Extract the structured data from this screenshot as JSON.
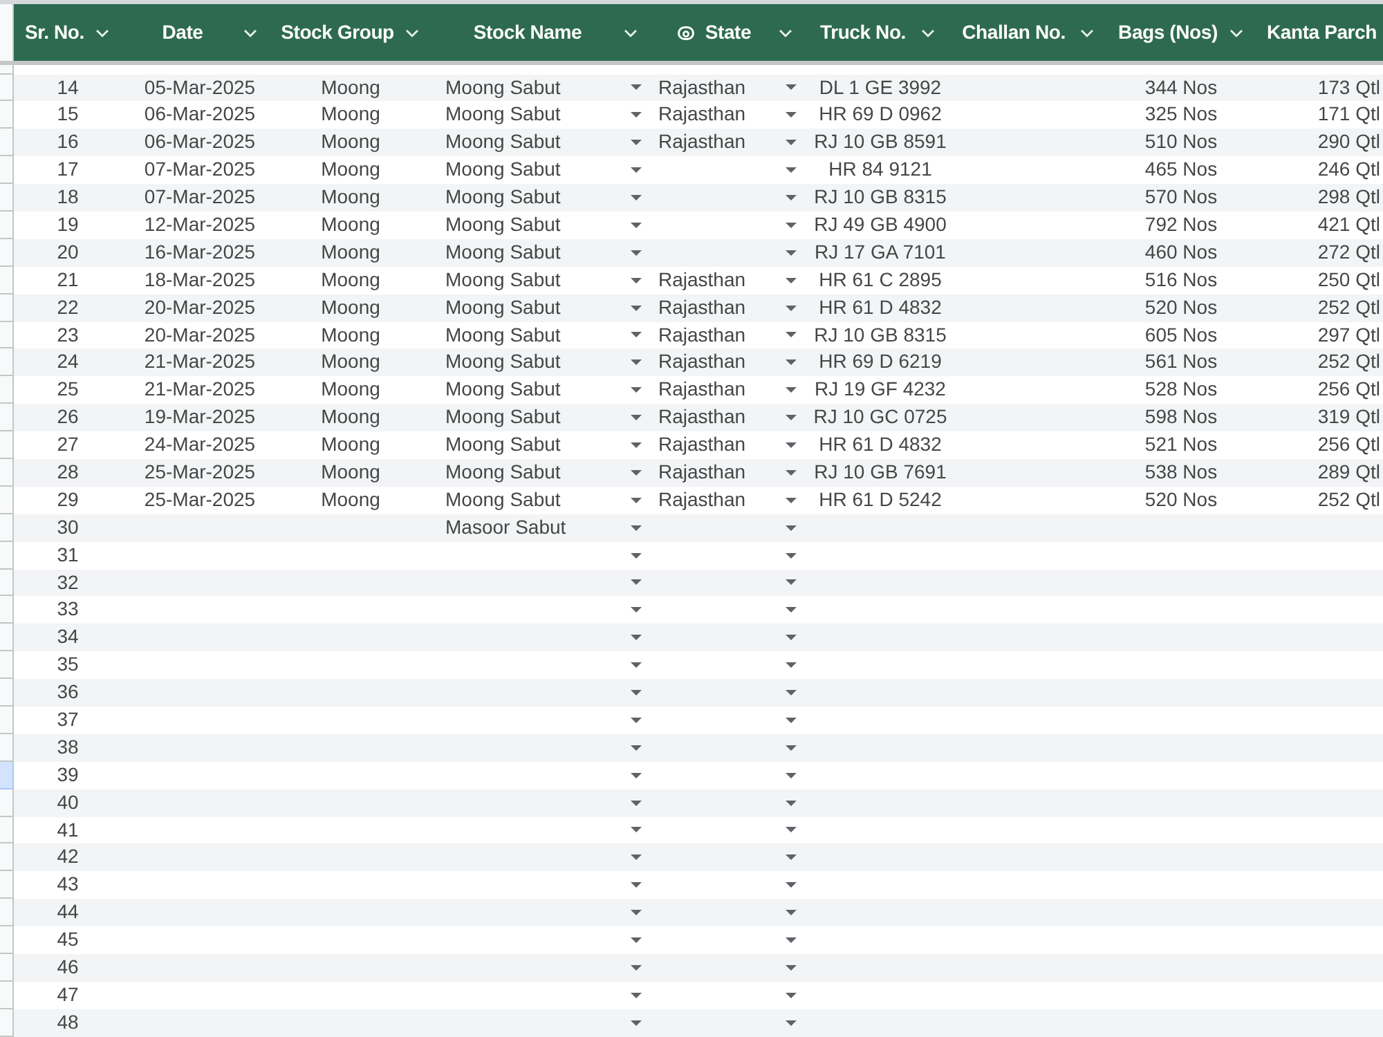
{
  "sheet": {
    "columns": [
      {
        "label": "Sr. No.",
        "kind": "text",
        "filter": true
      },
      {
        "label": "Date",
        "kind": "text",
        "filter": true
      },
      {
        "label": "Stock Group",
        "kind": "text",
        "filter": true
      },
      {
        "label": "Stock Name",
        "kind": "dropdown",
        "filter": true
      },
      {
        "label": "State",
        "kind": "chip",
        "filter": true
      },
      {
        "label": "Truck No.",
        "kind": "text",
        "filter": true
      },
      {
        "label": "Challan No.",
        "kind": "text",
        "filter": true
      },
      {
        "label": "Bags (Nos)",
        "kind": "text",
        "filter": true
      },
      {
        "label": "Kanta Parch",
        "kind": "text",
        "filter": false
      }
    ],
    "rows": [
      {
        "sr_no": "14",
        "date": "05-Mar-2025",
        "stock_group": "Moong",
        "stock_name": "Moong Sabut",
        "state": "Rajasthan",
        "truck_no": "DL 1 GE 3992",
        "bags_nos": "344 Nos",
        "column_9": "173 Qtl",
        "selected": false
      },
      {
        "sr_no": "15",
        "date": "06-Mar-2025",
        "stock_group": "Moong",
        "stock_name": "Moong Sabut",
        "state": "Rajasthan",
        "truck_no": "HR 69 D 0962",
        "bags_nos": "325 Nos",
        "column_9": "171 Qtl",
        "selected": false
      },
      {
        "sr_no": "16",
        "date": "06-Mar-2025",
        "stock_group": "Moong",
        "stock_name": "Moong Sabut",
        "state": "Rajasthan",
        "truck_no": "RJ 10 GB 8591",
        "bags_nos": "510 Nos",
        "column_9": "290 Qtl",
        "selected": false
      },
      {
        "sr_no": "17",
        "date": "07-Mar-2025",
        "stock_group": "Moong",
        "stock_name": "Moong Sabut",
        "truck_no": "HR 84 9121",
        "bags_nos": "465 Nos",
        "column_9": "246 Qtl",
        "selected": false
      },
      {
        "sr_no": "18",
        "date": "07-Mar-2025",
        "stock_group": "Moong",
        "stock_name": "Moong Sabut",
        "truck_no": "RJ 10 GB 8315",
        "bags_nos": "570 Nos",
        "column_9": "298 Qtl",
        "selected": false
      },
      {
        "sr_no": "19",
        "date": "12-Mar-2025",
        "stock_group": "Moong",
        "stock_name": "Moong Sabut",
        "truck_no": "RJ 49 GB 4900",
        "bags_nos": "792 Nos",
        "column_9": "421 Qtl",
        "selected": false
      },
      {
        "sr_no": "20",
        "date": "16-Mar-2025",
        "stock_group": "Moong",
        "stock_name": "Moong Sabut",
        "truck_no": "RJ 17 GA 7101",
        "bags_nos": "460 Nos",
        "column_9": "272 Qtl",
        "selected": false
      },
      {
        "sr_no": "21",
        "date": "18-Mar-2025",
        "stock_group": "Moong",
        "stock_name": "Moong Sabut",
        "state": "Rajasthan",
        "truck_no": "HR 61 C 2895",
        "bags_nos": "516 Nos",
        "column_9": "250 Qtl",
        "selected": false
      },
      {
        "sr_no": "22",
        "date": "20-Mar-2025",
        "stock_group": "Moong",
        "stock_name": "Moong Sabut",
        "state": "Rajasthan",
        "truck_no": "HR 61 D 4832",
        "bags_nos": "520 Nos",
        "column_9": "252 Qtl",
        "selected": false
      },
      {
        "sr_no": "23",
        "date": "20-Mar-2025",
        "stock_group": "Moong",
        "stock_name": "Moong Sabut",
        "state": "Rajasthan",
        "truck_no": "RJ 10 GB 8315",
        "bags_nos": "605 Nos",
        "column_9": "297 Qtl",
        "selected": false
      },
      {
        "sr_no": "24",
        "date": "21-Mar-2025",
        "stock_group": "Moong",
        "stock_name": "Moong Sabut",
        "state": "Rajasthan",
        "truck_no": "HR 69 D 6219",
        "bags_nos": "561 Nos",
        "column_9": "252 Qtl",
        "selected": false
      },
      {
        "sr_no": "25",
        "date": "21-Mar-2025",
        "stock_group": "Moong",
        "stock_name": "Moong Sabut",
        "state": "Rajasthan",
        "truck_no": "RJ 19 GF 4232",
        "bags_nos": "528 Nos",
        "column_9": "256 Qtl",
        "selected": false
      },
      {
        "sr_no": "26",
        "date": "19-Mar-2025",
        "stock_group": "Moong",
        "stock_name": "Moong Sabut",
        "state": "Rajasthan",
        "truck_no": "RJ 10 GC 0725",
        "bags_nos": "598 Nos",
        "column_9": "319 Qtl",
        "selected": false
      },
      {
        "sr_no": "27",
        "date": "24-Mar-2025",
        "stock_group": "Moong",
        "stock_name": "Moong Sabut",
        "state": "Rajasthan",
        "truck_no": "HR 61 D 4832",
        "bags_nos": "521 Nos",
        "column_9": "256 Qtl",
        "selected": false
      },
      {
        "sr_no": "28",
        "date": "25-Mar-2025",
        "stock_group": "Moong",
        "stock_name": "Moong Sabut",
        "state": "Rajasthan",
        "truck_no": "RJ 10 GB 7691",
        "bags_nos": "538 Nos",
        "column_9": "289 Qtl",
        "selected": false
      },
      {
        "sr_no": "29",
        "date": "25-Mar-2025",
        "stock_group": "Moong",
        "stock_name": "Moong Sabut",
        "state": "Rajasthan",
        "truck_no": "HR 61 D 5242",
        "bags_nos": "520 Nos",
        "column_9": "252 Qtl",
        "selected": false
      },
      {
        "sr_no": "30",
        "stock_name": "Masoor Sabut",
        "selected": false
      },
      {
        "sr_no": "31",
        "selected": false
      },
      {
        "sr_no": "32",
        "selected": false
      },
      {
        "sr_no": "33",
        "selected": false
      },
      {
        "sr_no": "34",
        "selected": false
      },
      {
        "sr_no": "35",
        "selected": false
      },
      {
        "sr_no": "36",
        "selected": false
      },
      {
        "sr_no": "37",
        "selected": false
      },
      {
        "sr_no": "38",
        "selected": false
      },
      {
        "sr_no": "39",
        "selected": true
      },
      {
        "sr_no": "40",
        "selected": false
      },
      {
        "sr_no": "41",
        "selected": false
      },
      {
        "sr_no": "42",
        "selected": false
      },
      {
        "sr_no": "43",
        "selected": false
      },
      {
        "sr_no": "44",
        "selected": false
      },
      {
        "sr_no": "45",
        "selected": false
      },
      {
        "sr_no": "46",
        "selected": false
      },
      {
        "sr_no": "47",
        "selected": false
      },
      {
        "sr_no": "48",
        "selected": false
      }
    ]
  }
}
